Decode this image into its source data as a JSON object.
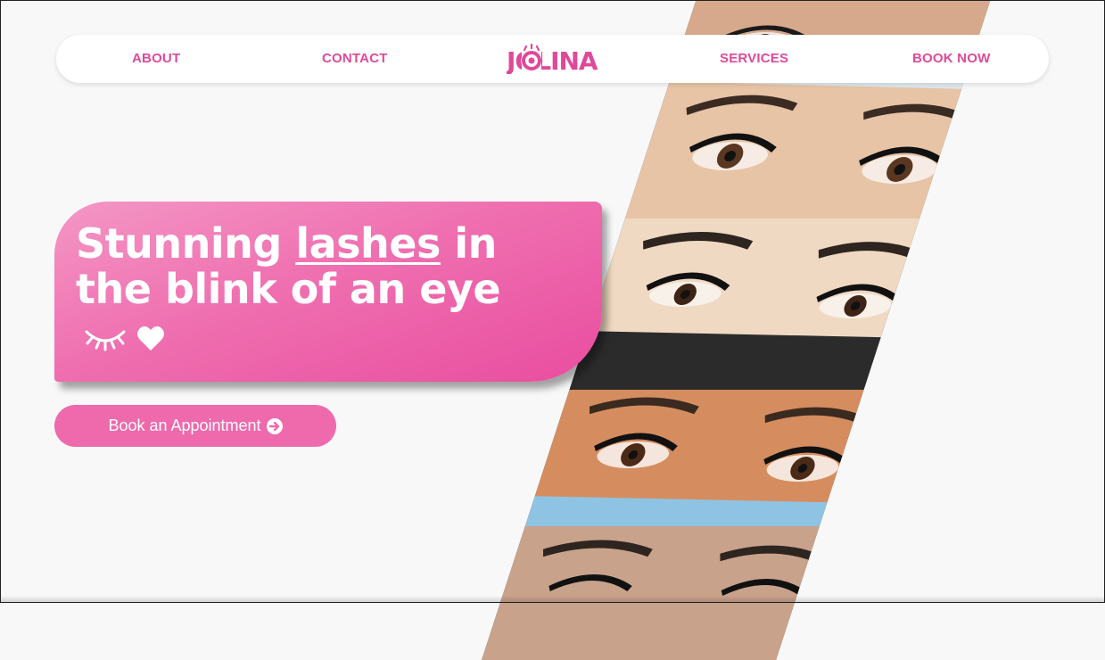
{
  "nav": {
    "links": [
      "ABOUT",
      "CONTACT",
      "SERVICES",
      "BOOK NOW"
    ],
    "logo_text": "JOLINA"
  },
  "hero": {
    "headline_part1": "Stunning ",
    "headline_underlined": "lashes",
    "headline_part2": " in",
    "headline_line2": "the blink of an eye",
    "icons": [
      "closed-eye-lashes-icon",
      "heart-icon"
    ]
  },
  "cta": {
    "label": "Book an Appointment",
    "icon": "arrow-circle-right-icon"
  },
  "gallery": {
    "photos": [
      "lashes-photo-1",
      "lashes-photo-2",
      "lashes-photo-3",
      "lashes-photo-4",
      "lashes-photo-5"
    ]
  },
  "colors": {
    "brand_pink": "#e0499a",
    "background": "#f8f8f9",
    "button_pink": "#ee6aac"
  }
}
